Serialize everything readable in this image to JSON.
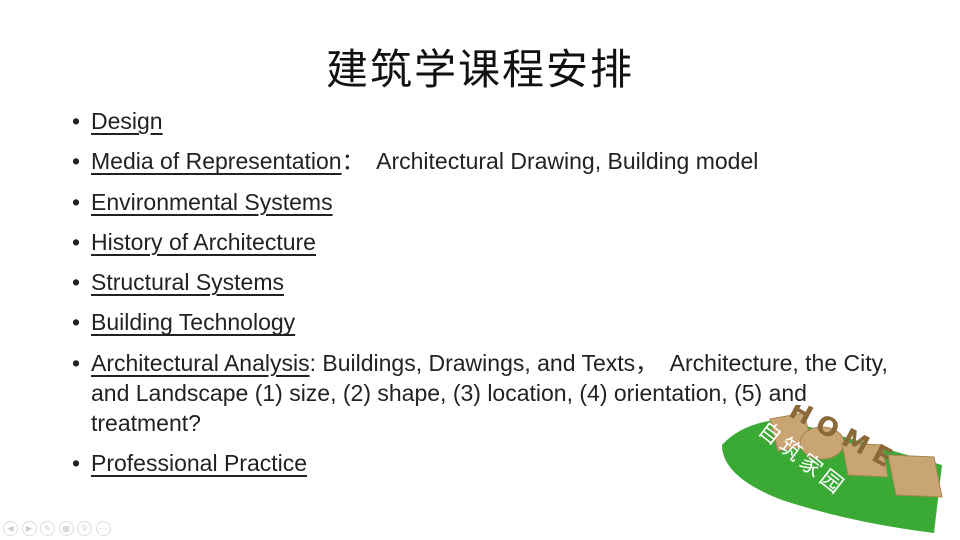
{
  "slide": {
    "title": "建筑学课程安排",
    "bullet_glyph": "•",
    "items": [
      {
        "heading": "Design",
        "rest": ""
      },
      {
        "heading": "Media of Representation",
        "rest": "：  Architectural Drawing, Building model"
      },
      {
        "heading": "Environmental Systems",
        "rest": ""
      },
      {
        "heading": "History of Architecture",
        "rest": ""
      },
      {
        "heading": "Structural Systems",
        "rest": ""
      },
      {
        "heading": "Building Technology",
        "rest": ""
      },
      {
        "heading": "Architectural Analysis",
        "rest": ": Buildings, Drawings, and Texts，  Architecture, the City, and Landscape (1) size, (2) shape, (3) location, (4) orientation, (5) and treatment?"
      },
      {
        "heading": "Professional Practice",
        "rest": ""
      }
    ]
  },
  "logo": {
    "word": "HOME",
    "chinese": "自筑家园",
    "colors": {
      "green": "#3aaa35",
      "wood": "#c9a574"
    }
  },
  "controls": [
    {
      "name": "previous",
      "glyph": "◀"
    },
    {
      "name": "next",
      "glyph": "▶"
    },
    {
      "name": "pen",
      "glyph": "✎"
    },
    {
      "name": "slides",
      "glyph": "▦"
    },
    {
      "name": "zoom",
      "glyph": "⚲"
    },
    {
      "name": "more",
      "glyph": "⋯"
    }
  ]
}
